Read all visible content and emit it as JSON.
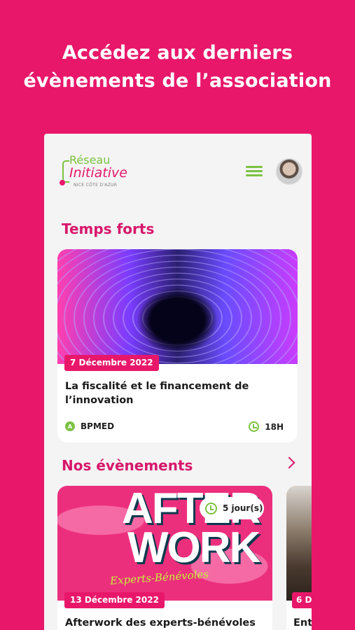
{
  "headline": {
    "line1": "Accédez aux derniers",
    "line2": "évènements de l’association"
  },
  "logo": {
    "line1": "Réseau",
    "line2": "Initiative",
    "line3": "NICE CÔTE D'AZUR"
  },
  "header": {
    "menu_icon": "hamburger-menu-icon",
    "avatar": "user-avatar"
  },
  "highlights": {
    "title": "Temps forts",
    "card": {
      "date": "7 Décembre 2022",
      "title": "La fiscalité et le financement de l’innovation",
      "org_icon_letter": "A",
      "org": "BPMED",
      "time": "18H"
    }
  },
  "events": {
    "title": "Nos évènements",
    "items": [
      {
        "image_word1": "AFTER",
        "image_word2": "WORK",
        "image_script": "Experts-Bénévoles",
        "countdown": "5 jour(s)",
        "date": "13 Décembre 2022",
        "title": "Afterwork des experts-bénévoles"
      },
      {
        "date": "6 D",
        "title": "Ent"
      }
    ]
  },
  "colors": {
    "background": "#e8176a",
    "accent_green": "#7cc242",
    "title_pink": "#d8176a"
  }
}
